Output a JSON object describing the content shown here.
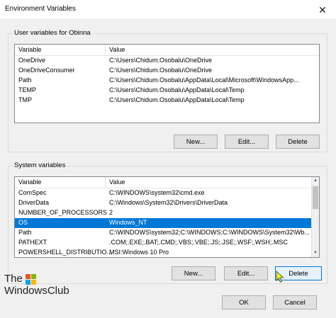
{
  "window": {
    "title": "Environment Variables",
    "close_glyph": "✕"
  },
  "user_section": {
    "label": "User variables for Obinna",
    "columns": [
      "Variable",
      "Value"
    ],
    "rows": [
      {
        "variable": "OneDrive",
        "value": "C:\\Users\\Chidum.Osobalu\\OneDrive"
      },
      {
        "variable": "OneDriveConsumer",
        "value": "C:\\Users\\Chidum.Osobalu\\OneDrive"
      },
      {
        "variable": "Path",
        "value": "C:\\Users\\Chidum.Osobalu\\AppData\\Local\\Microsoft\\WindowsApp..."
      },
      {
        "variable": "TEMP",
        "value": "C:\\Users\\Chidum.Osobalu\\AppData\\Local\\Temp"
      },
      {
        "variable": "TMP",
        "value": "C:\\Users\\Chidum.Osobalu\\AppData\\Local\\Temp"
      }
    ],
    "buttons": {
      "new": "New...",
      "edit": "Edit...",
      "delete": "Delete"
    }
  },
  "system_section": {
    "label": "System variables",
    "columns": [
      "Variable",
      "Value"
    ],
    "rows": [
      {
        "variable": "ComSpec",
        "value": "C:\\WINDOWS\\system32\\cmd.exe"
      },
      {
        "variable": "DriverData",
        "value": "C:\\Windows\\System32\\Drivers\\DriverData"
      },
      {
        "variable": "NUMBER_OF_PROCESSORS",
        "value": "2"
      },
      {
        "variable": "OS",
        "value": "Windows_NT"
      },
      {
        "variable": "Path",
        "value": "C:\\WINDOWS\\system32;C:\\WINDOWS;C:\\WINDOWS\\System32\\Wb..."
      },
      {
        "variable": "PATHEXT",
        "value": ".COM;.EXE;.BAT;.CMD;.VBS;.VBE;.JS;.JSE;.WSF;.WSH;.MSC"
      },
      {
        "variable": "POWERSHELL_DISTRIBUTIO...",
        "value": "MSI:Windows 10 Pro"
      }
    ],
    "selected_row": "OS",
    "buttons": {
      "new": "New...",
      "edit": "Edit...",
      "delete": "Delete"
    }
  },
  "footer": {
    "ok": "OK",
    "cancel": "Cancel"
  },
  "watermark": {
    "line1": "The",
    "line2": "WindowsClub"
  },
  "colors": {
    "selection": "#0078d7",
    "dialog_bg": "#f0f0f0"
  }
}
